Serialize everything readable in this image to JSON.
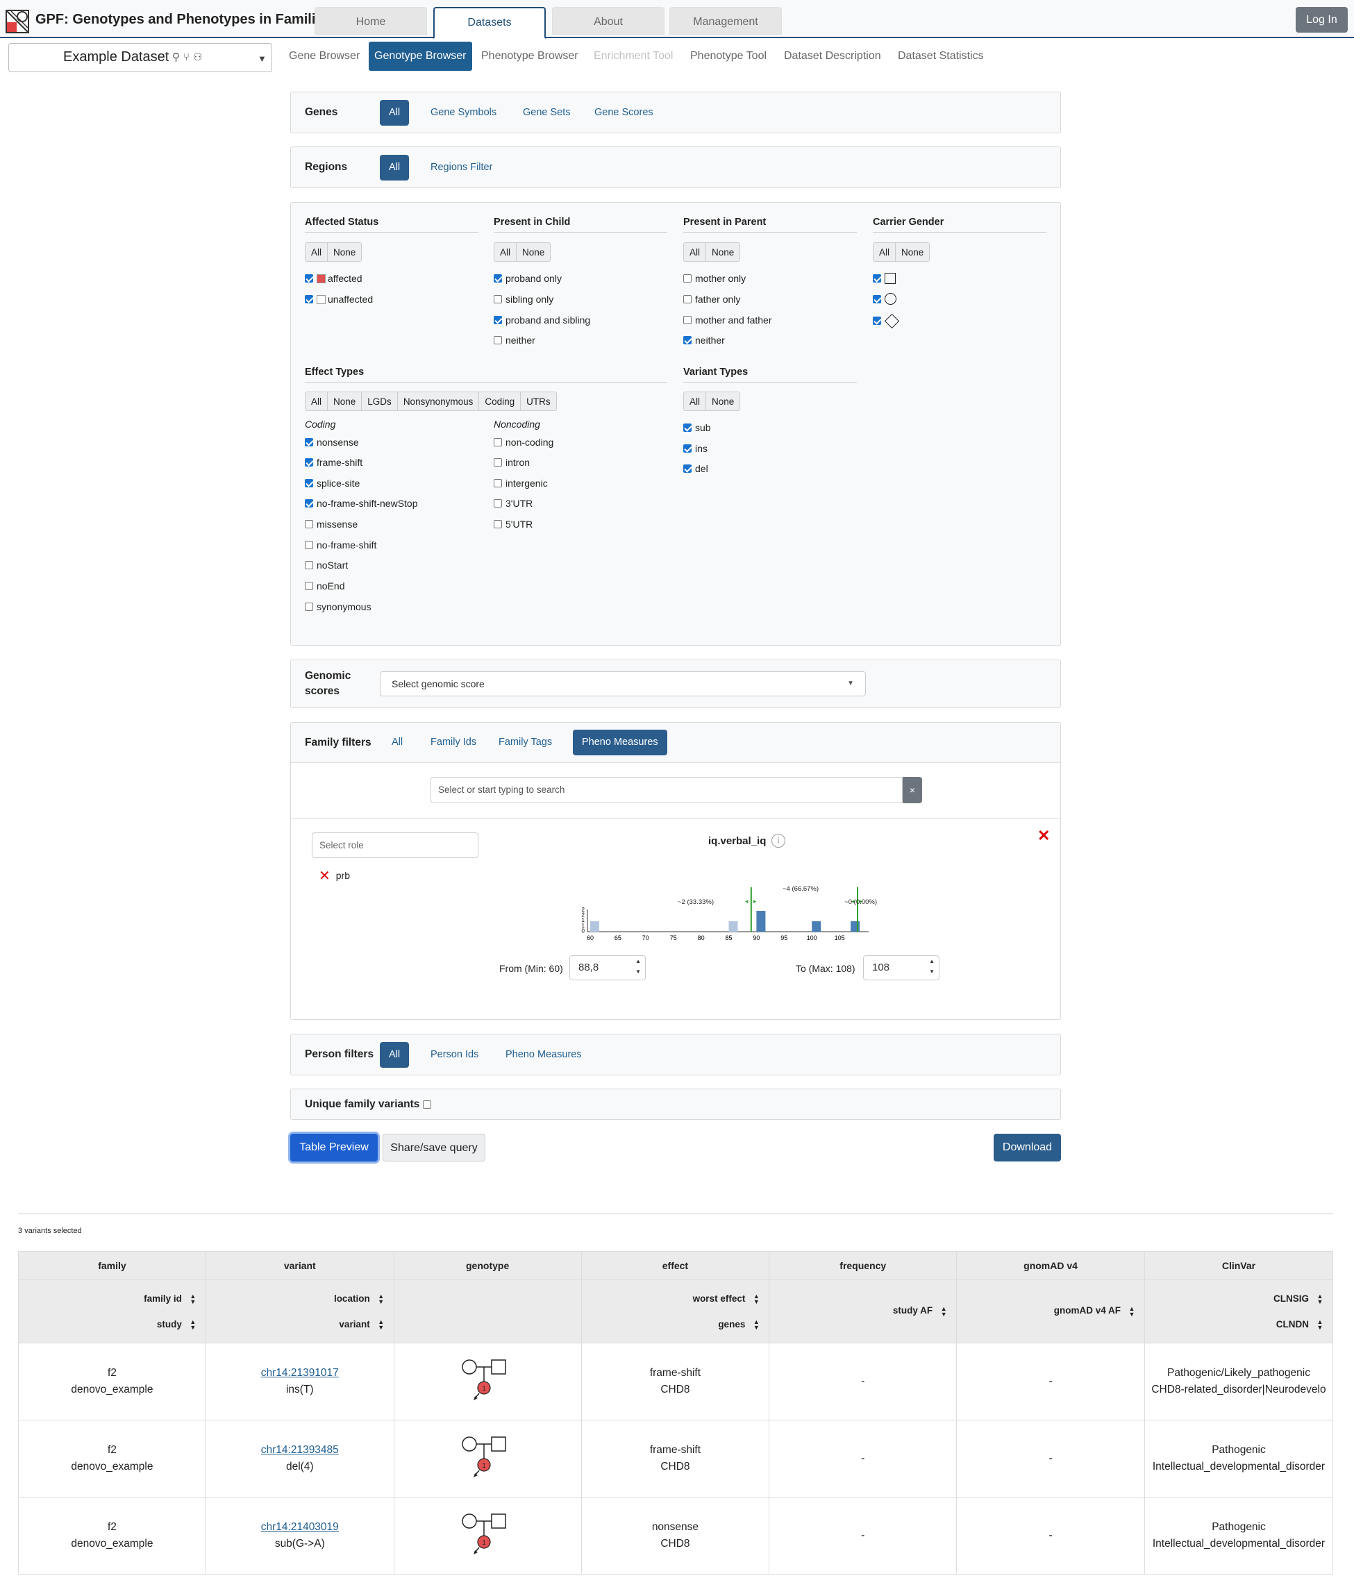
{
  "app": {
    "title": "GPF: Genotypes and Phenotypes in Families",
    "login": "Log In"
  },
  "maintabs": [
    {
      "label": "Home"
    },
    {
      "label": "Datasets"
    },
    {
      "label": "About"
    },
    {
      "label": "Management"
    }
  ],
  "dataset": {
    "name": "Example Dataset"
  },
  "subtabs": [
    {
      "label": "Gene Browser"
    },
    {
      "label": "Genotype Browser"
    },
    {
      "label": "Phenotype Browser"
    },
    {
      "label": "Enrichment Tool"
    },
    {
      "label": "Phenotype Tool"
    },
    {
      "label": "Dataset Description"
    },
    {
      "label": "Dataset Statistics"
    }
  ],
  "genes": {
    "label": "Genes",
    "tabs": [
      "All",
      "Gene Symbols",
      "Gene Sets",
      "Gene Scores"
    ]
  },
  "regions": {
    "label": "Regions",
    "tabs": [
      "All",
      "Regions Filter"
    ]
  },
  "filters": {
    "all": "All",
    "none": "None",
    "affected_status": {
      "title": "Affected Status",
      "items": [
        "affected",
        "unaffected"
      ]
    },
    "present_in_child": {
      "title": "Present in Child",
      "items": [
        "proband only",
        "sibling only",
        "proband and sibling",
        "neither"
      ]
    },
    "present_in_parent": {
      "title": "Present in Parent",
      "items": [
        "mother only",
        "father only",
        "mother and father",
        "neither"
      ]
    },
    "carrier_gender": {
      "title": "Carrier Gender"
    },
    "effect_types": {
      "title": "Effect Types",
      "buttons": [
        "All",
        "None",
        "LGDs",
        "Nonsynonymous",
        "Coding",
        "UTRs"
      ],
      "coding_label": "Coding",
      "noncoding_label": "Noncoding",
      "coding": [
        "nonsense",
        "frame-shift",
        "splice-site",
        "no-frame-shift-newStop",
        "missense",
        "no-frame-shift",
        "noStart",
        "noEnd",
        "synonymous"
      ],
      "noncoding": [
        "non-coding",
        "intron",
        "intergenic",
        "3'UTR",
        "5'UTR"
      ]
    },
    "variant_types": {
      "title": "Variant Types",
      "items": [
        "sub",
        "ins",
        "del"
      ]
    }
  },
  "genomic_scores": {
    "label1": "Genomic",
    "label2": "scores",
    "placeholder": "Select genomic score"
  },
  "family_filters": {
    "label": "Family filters",
    "tabs": [
      "All",
      "Family Ids",
      "Family Tags",
      "Pheno Measures"
    ],
    "search_placeholder": "Select or start typing to search",
    "clear": "×"
  },
  "pheno_measure": {
    "role_placeholder": "Select role",
    "role": "prb",
    "title": "iq.verbal_iq",
    "from_label": "From (Min: 60)",
    "from_value": "88,8",
    "to_label": "To (Max: 108)",
    "to_value": "108",
    "left_annot": "~2 (33.33%)",
    "mid_annot": "~4 (66.67%)",
    "right_annot": "~0 (0.00%)"
  },
  "chart_data": {
    "type": "bar",
    "x_ticks": [
      "60",
      "65",
      "70",
      "75",
      "80",
      "85",
      "90",
      "95",
      "100",
      "105"
    ],
    "y_ticks": [
      "2",
      "2",
      "1",
      "1",
      "0"
    ],
    "bins": [
      {
        "x": 60,
        "count": 1,
        "selected": false
      },
      {
        "x": 85,
        "count": 1,
        "selected": false
      },
      {
        "x": 90,
        "count": 2,
        "selected": true
      },
      {
        "x": 100,
        "count": 1,
        "selected": true
      },
      {
        "x": 107,
        "count": 1,
        "selected": true
      }
    ],
    "xlim": [
      60,
      110
    ],
    "ylim": [
      0,
      2
    ],
    "range_markers": [
      88.8,
      108
    ]
  },
  "person_filters": {
    "label": "Person filters",
    "tabs": [
      "All",
      "Person Ids",
      "Pheno Measures"
    ]
  },
  "unique": {
    "label": "Unique family variants"
  },
  "actions": {
    "table_preview": "Table Preview",
    "share": "Share/save query",
    "download": "Download"
  },
  "results": {
    "count_text": "3 variants selected",
    "groups": [
      "family",
      "variant",
      "genotype",
      "effect",
      "frequency",
      "gnomAD v4",
      "ClinVar"
    ],
    "sub": {
      "family_id": "family id",
      "study": "study",
      "location": "location",
      "variant": "variant",
      "worst_effect": "worst effect",
      "genes": "genes",
      "study_af": "study AF",
      "gnomad_af": "gnomAD v4 AF",
      "clnsig": "CLNSIG",
      "clndn": "CLNDN"
    },
    "rows": [
      {
        "family": "f2",
        "study": "denovo_example",
        "location": "chr14:21391017",
        "variant": "ins(T)",
        "effect": "frame-shift",
        "gene": "CHD8",
        "af": "-",
        "gnomad": "-",
        "clnsig": "Pathogenic/Likely_pathogenic",
        "clndn": "CHD8-related_disorder|Neurodevelo"
      },
      {
        "family": "f2",
        "study": "denovo_example",
        "location": "chr14:21393485",
        "variant": "del(4)",
        "effect": "frame-shift",
        "gene": "CHD8",
        "af": "-",
        "gnomad": "-",
        "clnsig": "Pathogenic",
        "clndn": "Intellectual_developmental_disorder"
      },
      {
        "family": "f2",
        "study": "denovo_example",
        "location": "chr14:21403019",
        "variant": "sub(G->A)",
        "effect": "nonsense",
        "gene": "CHD8",
        "af": "-",
        "gnomad": "-",
        "clnsig": "Pathogenic",
        "clndn": "Intellectual_developmental_disorder"
      }
    ]
  },
  "colors": {
    "accent": "#2a5c8c",
    "affected": "#e05050",
    "histogram_selected": "#4a7fb5",
    "histogram_unselected": "#b3c6e0",
    "marker": "#2ca02c",
    "close": "#e00000"
  }
}
